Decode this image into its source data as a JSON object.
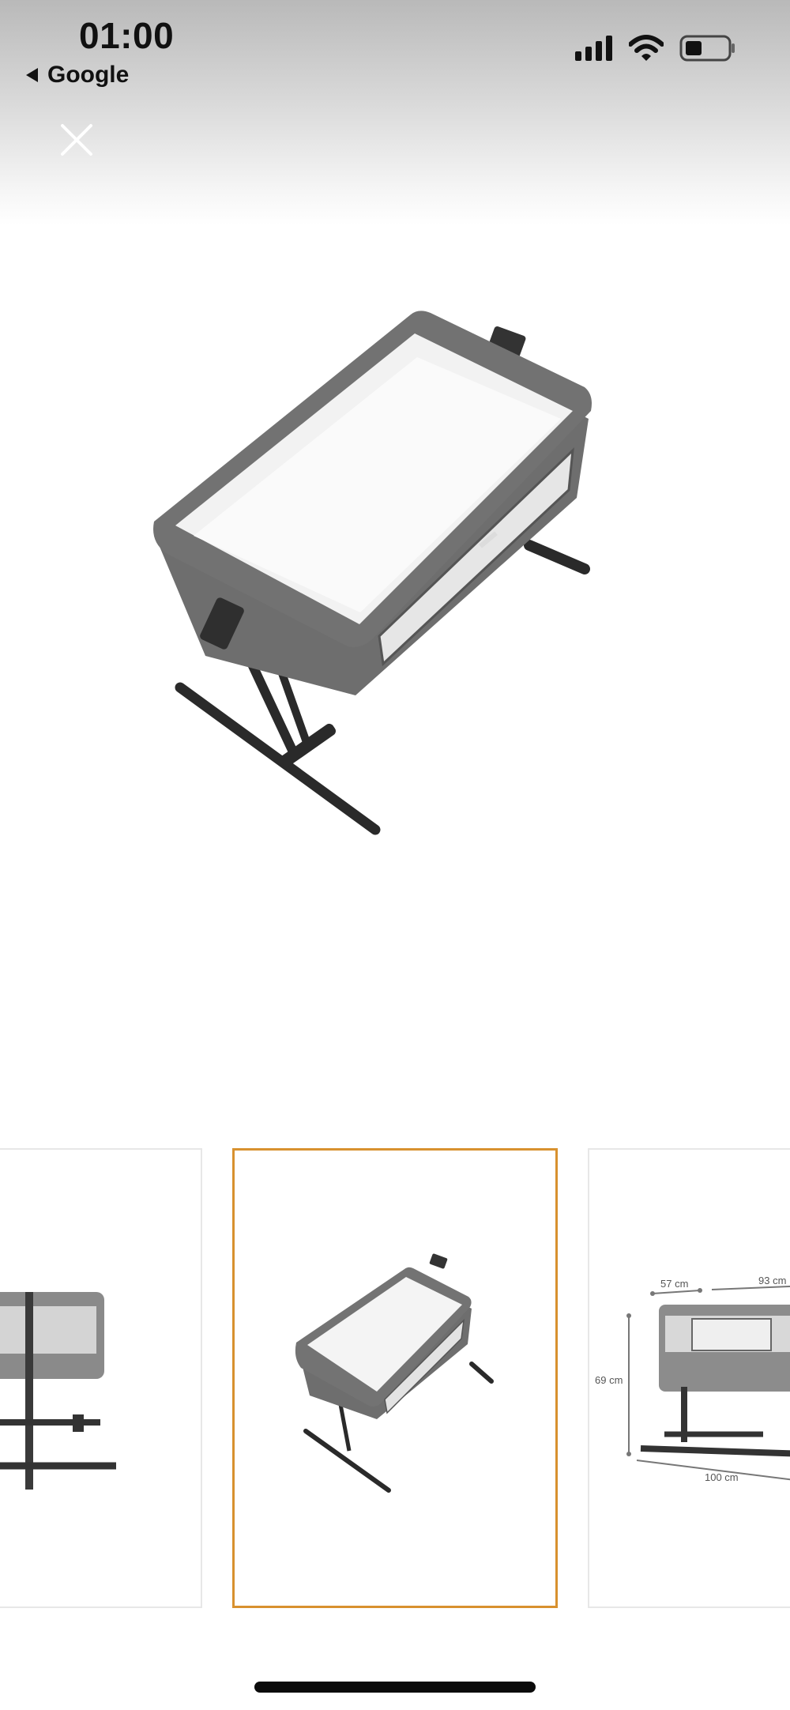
{
  "status_bar": {
    "time": "01:00",
    "back_label": "Google",
    "icons": [
      "signal-bars-icon",
      "wifi-icon",
      "battery-icon"
    ]
  },
  "viewer": {
    "close_icon": "close-icon",
    "image_subject": "bedside crib"
  },
  "thumbnails": [
    {
      "name": "thumbnail-crib-front",
      "selected": false
    },
    {
      "name": "thumbnail-crib-angled",
      "selected": true
    },
    {
      "name": "thumbnail-crib-dimensions",
      "selected": false,
      "dimensions": {
        "width": "57 cm",
        "length": "93 cm",
        "height": "69 cm",
        "leg_span": "100 cm"
      }
    }
  ],
  "colors": {
    "selected_border": "#d8912f",
    "frame_gray": "#6e6e6e",
    "leg_black": "#2a2a2a"
  }
}
